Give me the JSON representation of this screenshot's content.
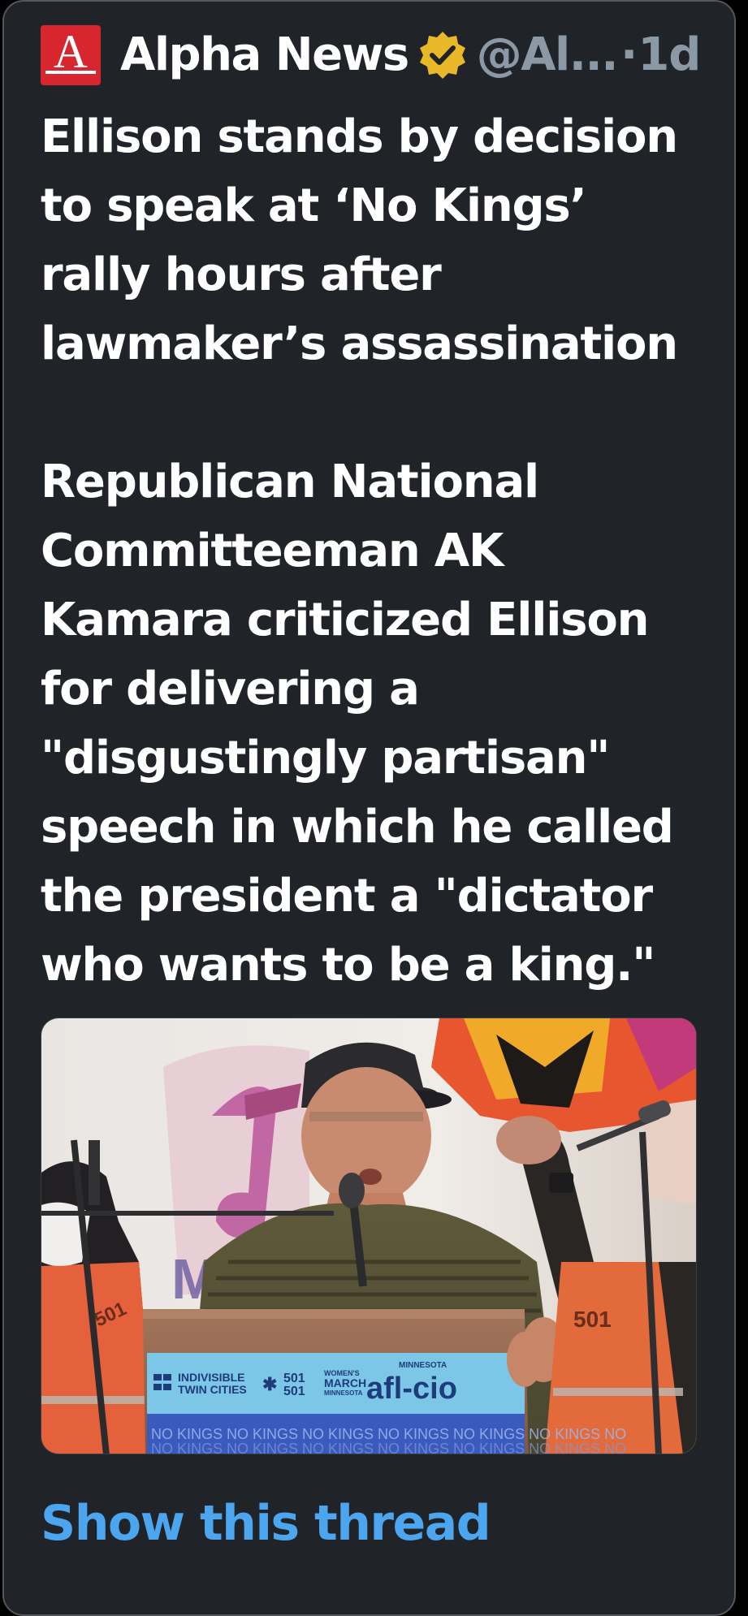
{
  "tweet": {
    "author_name": "Alpha News",
    "handle": "@Al...",
    "separator": "·",
    "time": "1d",
    "logo_letter": "A",
    "text_headline": "Ellison stands by decision\nto speak at ‘No Kings’\nrally hours after\nlawmaker’s assassination",
    "text_body": "Republican National\nCommitteeman AK\nKamara criticized Ellison\nfor delivering a\n\"disgustingly partisan\"\nspeech in which he called\nthe president a \"dictator\nwho wants to be a king.\"",
    "media": {
      "podium_sign": {
        "indivisible": "INDIVISIBLE",
        "twin_cities": "TWIN CITIES",
        "s501_top": "501",
        "s501_bottom": "501",
        "womens": "WOMEN'S",
        "march": "MARCH",
        "minnesota_small": "MINNESOTA",
        "afl": "afl-cio",
        "minnesota_top": "MINNESOTA"
      },
      "banner_text": "NO KINGS NO KINGS NO KINGS NO KINGS NO KINGS NO KINGS NO",
      "poster_letter": "M",
      "vest_number": "501"
    },
    "show_thread_label": "Show this thread"
  },
  "colors": {
    "card_background": "#202327",
    "text_primary": "#ffffff",
    "text_secondary": "#8b98a5",
    "link": "#4ba5ef",
    "verified_gold": "#e8b829",
    "logo_red": "#d8262f"
  },
  "icons": {
    "logo": "alpha-news-logo",
    "verified": "verified-badge-icon"
  }
}
